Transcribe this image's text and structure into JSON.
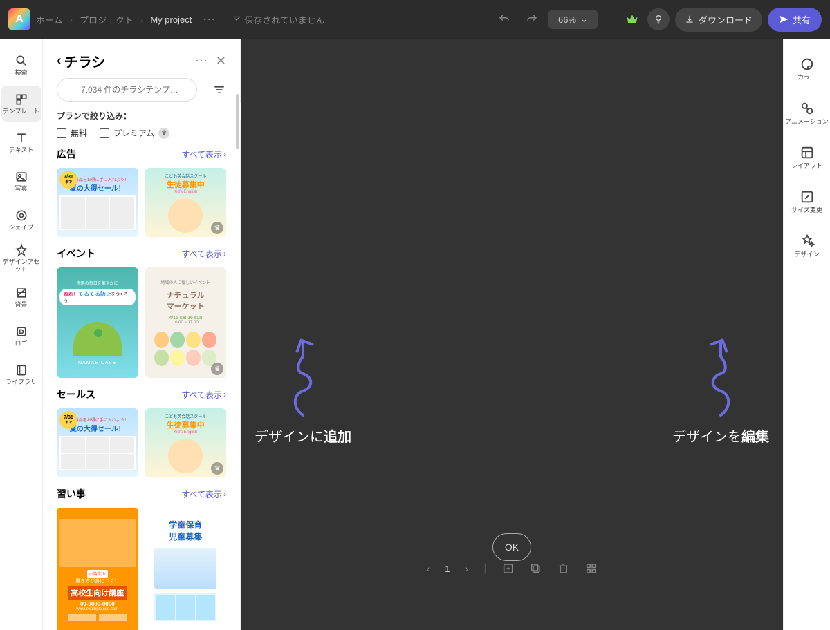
{
  "topbar": {
    "breadcrumb": {
      "home": "ホーム",
      "projects": "プロジェクト",
      "current": "My project"
    },
    "save_status": "保存されていません",
    "zoom": "66%",
    "download": "ダウンロード",
    "share": "共有"
  },
  "leftbar": {
    "items": [
      {
        "label": "検索",
        "icon": "search"
      },
      {
        "label": "テンプレート",
        "icon": "template",
        "active": true
      },
      {
        "label": "テキスト",
        "icon": "text"
      },
      {
        "label": "写真",
        "icon": "photo"
      },
      {
        "label": "シェイプ",
        "icon": "shape"
      },
      {
        "label": "デザインアセット",
        "icon": "asset"
      },
      {
        "label": "背景",
        "icon": "background"
      },
      {
        "label": "ロゴ",
        "icon": "logo"
      },
      {
        "label": "ライブラリ",
        "icon": "library"
      }
    ]
  },
  "panel": {
    "title": "チラシ",
    "search_placeholder": "7,034 件のチラシテンプ…",
    "filter_title": "プランで絞り込み：",
    "filter_free": "無料",
    "filter_premium": "プレミアム",
    "sections": [
      {
        "title": "広告",
        "more": "すべて表示"
      },
      {
        "title": "イベント",
        "more": "すべて表示"
      },
      {
        "title": "セールス",
        "more": "すべて表示"
      },
      {
        "title": "習い事",
        "more": "すべて表示"
      }
    ]
  },
  "canvas": {
    "callout_left_a": "デザインに",
    "callout_left_b": "追加",
    "callout_right_a": "デザインを",
    "callout_right_b": "編集",
    "ok": "OK",
    "page_num": "1"
  },
  "rightbar": {
    "items": [
      {
        "label": "カラー"
      },
      {
        "label": "アニメーション"
      },
      {
        "label": "レイアウト"
      },
      {
        "label": "サイズ変更"
      },
      {
        "label": "デザイン"
      }
    ]
  },
  "thumb_text": {
    "sale_date": "7/31",
    "sale_sub": "まで",
    "sale_line1": "家電製品をお得に手に入れよう！",
    "sale_line2": "夏の大得セール！",
    "kids_line1": "こども英会話スクール",
    "kids_line2": "生徒募集中",
    "kids_line3": "Kid's English",
    "teru_line1": "梅雨の毎日を華やかに",
    "teru_line2": "照れ！",
    "teru_line3": "てるてる防止",
    "teru_line4": "をつくろう",
    "teru_cafe": "NAMAE CAFE",
    "natural_line1": "地域の人に優しいイベント",
    "natural_line2": "ナチュラル",
    "natural_line3": "マーケット",
    "natural_date": "4/15 sat 16 sun",
    "natural_time": "10:00 ~ 17:00",
    "hs_line1": "小論文の",
    "hs_line2": "書き方が身につく！",
    "hs_line3": "高校生向け講座",
    "hs_tel": "00-0000-0000",
    "hs_url": "www.example.site.com",
    "child_line1": "学童保育",
    "child_line2": "児童募集"
  }
}
